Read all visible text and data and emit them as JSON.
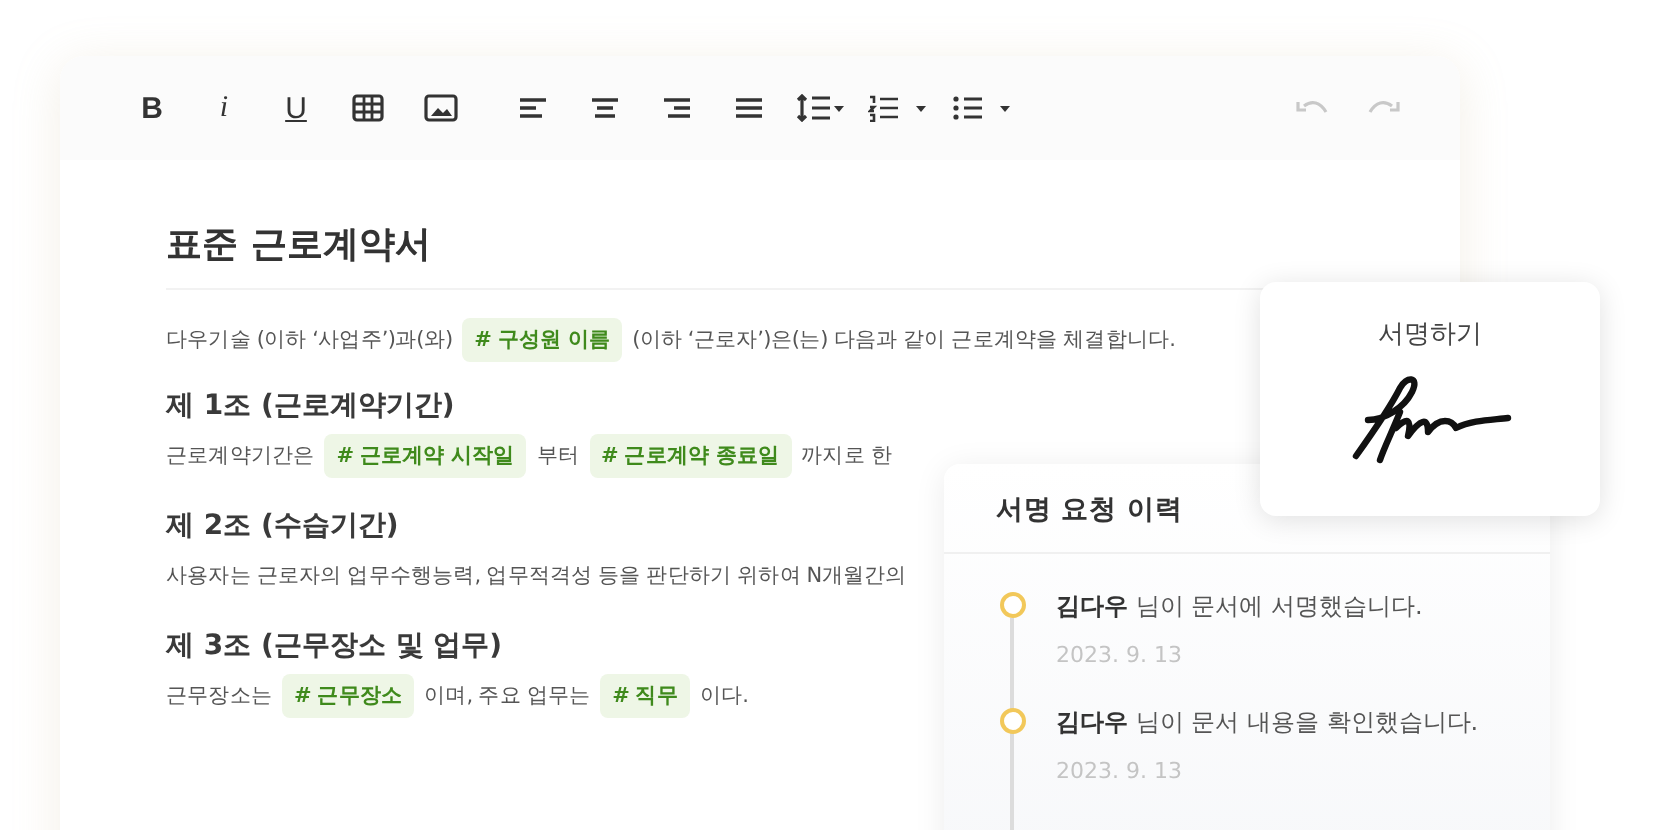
{
  "toolbar": [
    {
      "kind": "bold",
      "label": "B",
      "disabled": false
    },
    {
      "kind": "italic",
      "label": "i",
      "disabled": false
    },
    {
      "kind": "underline",
      "label": "U",
      "disabled": false
    },
    {
      "kind": "table",
      "disabled": false
    },
    {
      "kind": "image",
      "disabled": false
    },
    {
      "kind": "align-left",
      "disabled": false
    },
    {
      "kind": "align-center",
      "disabled": false
    },
    {
      "kind": "align-right",
      "disabled": false
    },
    {
      "kind": "justify",
      "disabled": false
    },
    {
      "kind": "line-height",
      "disabled": false
    },
    {
      "kind": "ordered-list",
      "disabled": false
    },
    {
      "kind": "bullet-list",
      "disabled": false
    },
    {
      "kind": "undo",
      "disabled": true
    },
    {
      "kind": "redo",
      "disabled": true
    }
  ],
  "document": {
    "title": "표준 근로계약서",
    "blocks": [
      {
        "kind": "text",
        "segments": [
          {
            "kind": "text",
            "text": "다우기술 (이하 ‘사업주’)과(와)"
          },
          {
            "kind": "tag",
            "text": "# 구성원 이름"
          },
          {
            "kind": "text",
            "text": "(이하 ‘근로자’)은(는) 다음과 같이 근로계약을 체결합니다."
          }
        ]
      },
      {
        "kind": "heading",
        "segments": [
          {
            "kind": "text",
            "text": "제 1조 (근로계약기간)"
          }
        ]
      },
      {
        "kind": "text",
        "segments": [
          {
            "kind": "text",
            "text": "근로계약기간은"
          },
          {
            "kind": "tag",
            "text": "# 근로계약 시작일"
          },
          {
            "kind": "text",
            "text": "부터"
          },
          {
            "kind": "tag",
            "text": "# 근로계약 종료일"
          },
          {
            "kind": "text",
            "text": "까지로 한"
          }
        ]
      },
      {
        "kind": "heading",
        "segments": [
          {
            "kind": "text",
            "text": "제 2조 (수습기간)"
          }
        ]
      },
      {
        "kind": "text",
        "segments": [
          {
            "kind": "text",
            "text": "사용자는 근로자의 업무수행능력, 업무적격성 등을 판단하기 위하여 N개월간의"
          }
        ]
      },
      {
        "kind": "heading",
        "segments": [
          {
            "kind": "text",
            "text": "제 3조 (근무장소 및 업무)"
          }
        ]
      },
      {
        "kind": "text",
        "segments": [
          {
            "kind": "text",
            "text": "근무장소는"
          },
          {
            "kind": "tag",
            "text": "# 근무장소"
          },
          {
            "kind": "text",
            "text": "이며, 주요 업무는"
          },
          {
            "kind": "tag",
            "text": "# 직무"
          },
          {
            "kind": "text",
            "text": "이다."
          }
        ]
      }
    ]
  },
  "signature": {
    "title": "서명하기"
  },
  "history": {
    "title": "서명 요청 이력",
    "items": [
      {
        "message": "**김다우** 님이 문서에 서명했습니다.",
        "date": "2023. 9. 13"
      },
      {
        "message": "**김다우** 님이 문서 내용을 확인했습니다.",
        "date": "2023. 9. 13"
      }
    ]
  }
}
